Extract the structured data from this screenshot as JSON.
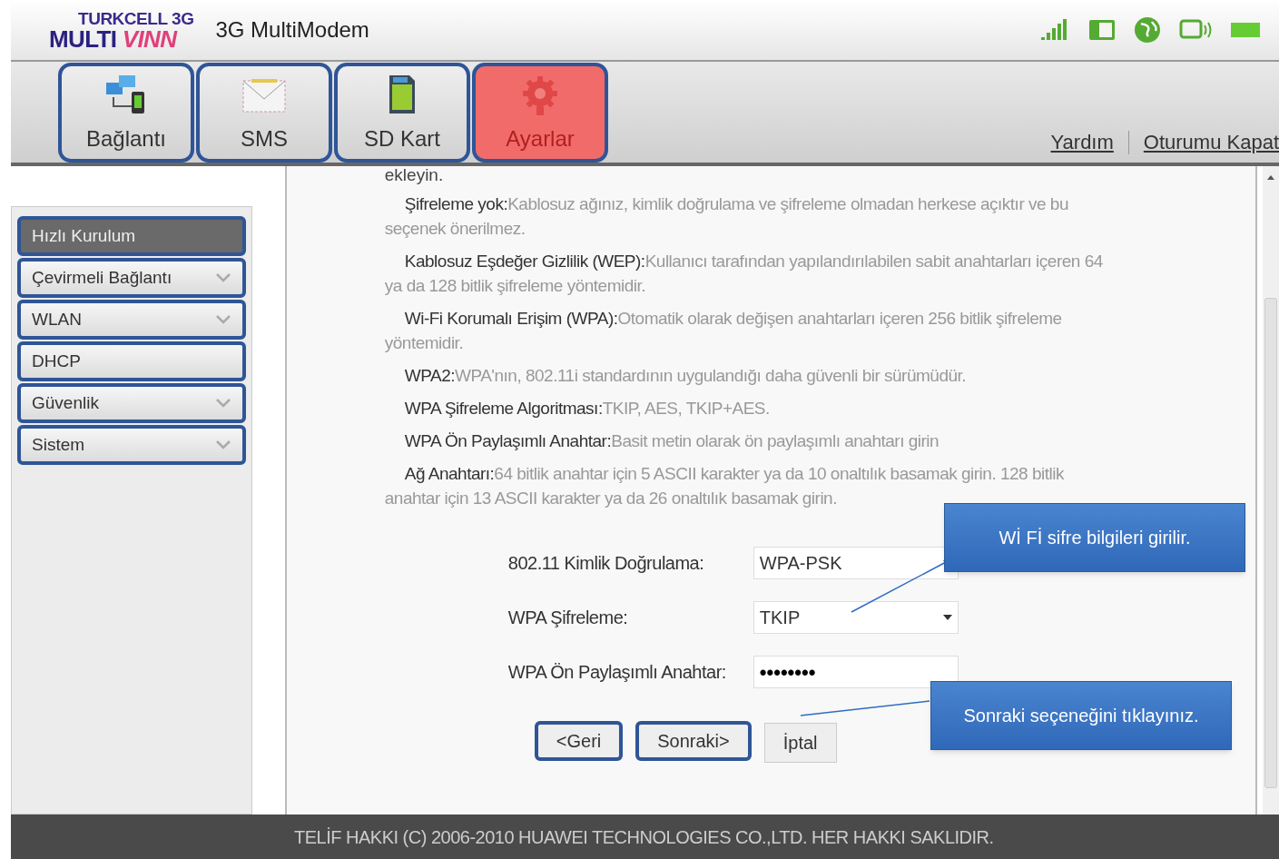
{
  "header": {
    "logo_top": "TURKCELL 3G",
    "logo_bottom_a": "MULTI",
    "logo_bottom_b": "VINN",
    "title": "3G MultiModem"
  },
  "tabs": [
    {
      "label": "Bağlantı",
      "selected": false
    },
    {
      "label": "SMS",
      "selected": false
    },
    {
      "label": "SD Kart",
      "selected": false
    },
    {
      "label": "Ayarlar",
      "selected": true
    }
  ],
  "top_links": [
    "Yardım",
    "Oturumu Kapat"
  ],
  "sidebar": [
    {
      "label": "Hızlı Kurulum",
      "selected": true,
      "expandable": false
    },
    {
      "label": "Çevirmeli Bağlantı",
      "selected": false,
      "expandable": true
    },
    {
      "label": "WLAN",
      "selected": false,
      "expandable": true
    },
    {
      "label": "DHCP",
      "selected": false,
      "expandable": false
    },
    {
      "label": "Güvenlik",
      "selected": false,
      "expandable": true
    },
    {
      "label": "Sistem",
      "selected": false,
      "expandable": true
    }
  ],
  "intro_fragment": "ekleyin.",
  "definitions": [
    {
      "term": "Şifreleme yok:",
      "text": "Kablosuz ağınız, kimlik doğrulama ve şifreleme olmadan herkese açıktır ve bu seçenek önerilmez."
    },
    {
      "term": "Kablosuz Eşdeğer Gizlilik (WEP):",
      "text": "Kullanıcı tarafından yapılandırılabilen sabit anahtarları içeren 64 ya da 128 bitlik şifreleme yöntemidir."
    },
    {
      "term": "Wi-Fi Korumalı Erişim (WPA):",
      "text": "Otomatik olarak değişen anahtarları içeren 256 bitlik şifreleme yöntemidir."
    },
    {
      "term": "WPA2:",
      "text": "WPA'nın, 802.11i standardının uygulandığı daha güvenli bir sürümüdür."
    },
    {
      "term": "WPA Şifreleme Algoritması:",
      "text": "TKIP, AES, TKIP+AES."
    },
    {
      "term": "WPA Ön Paylaşımlı Anahtar:",
      "text": "Basit metin olarak ön paylaşımlı anahtarı girin"
    },
    {
      "term": "Ağ Anahtarı:",
      "text": "64 bitlik anahtar için 5 ASCII karakter ya da 10 onaltılık basamak girin. 128 bitlik anahtar için 13 ASCII karakter ya da 26 onaltılık basamak girin."
    }
  ],
  "form": [
    {
      "label": "802.11 Kimlik Doğrulama:",
      "kind": "select",
      "value": "WPA-PSK"
    },
    {
      "label": "WPA Şifreleme:",
      "kind": "select",
      "value": "TKIP"
    },
    {
      "label": "WPA Ön Paylaşımlı Anahtar:",
      "kind": "password",
      "value": "••••••••"
    }
  ],
  "buttons": [
    {
      "label": "<Geri",
      "highlighted": true
    },
    {
      "label": "Sonraki>",
      "highlighted": true
    },
    {
      "label": "İptal",
      "highlighted": false
    }
  ],
  "callouts": [
    "Wİ Fİ sifre bilgileri girilir.",
    "Sonraki seçeneğini tıklayınız."
  ],
  "footer": "TELİF HAKKI (C) 2006-2010 HUAWEI TECHNOLOGIES CO.,LTD. HER HAKKI SAKLIDIR."
}
